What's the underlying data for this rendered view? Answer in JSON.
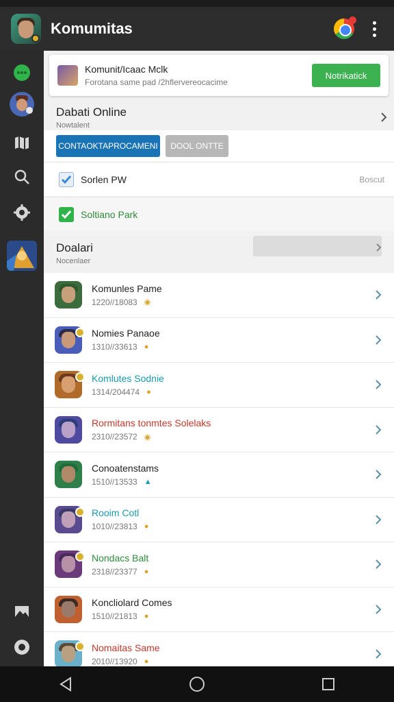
{
  "app": {
    "title": "Komumitas"
  },
  "promo": {
    "title": "Komunit/Icaac Mclk",
    "subtitle": "Forotana same pad /2hflervereocacime",
    "button": "Notrikatick"
  },
  "online_section": {
    "title": "Dabati Online",
    "subtitle": "Nowtalent"
  },
  "buttons": {
    "primary": "CONTAOKTAPROCAMENI",
    "secondary": "DOOL ONTTE"
  },
  "options": [
    {
      "label": "Sorlen PW",
      "side_text": "Boscut",
      "checked_style": "blue"
    },
    {
      "label": "Soltiano Park",
      "side_text": "",
      "checked_style": "green"
    }
  ],
  "list_section": {
    "title": "Doalari",
    "subtitle": "Nocenlaer"
  },
  "list": [
    {
      "title": "Komunles Pame",
      "sub": "1220//18083",
      "title_color": "#222222",
      "mark": "◉",
      "mark_color": "#d8a32a",
      "face": "#c7a07a",
      "hair": "#2f5a2f",
      "bg": "#3c6b3e",
      "badge": false
    },
    {
      "title": "Nomies Panaoe",
      "sub": "1310//33613",
      "title_color": "#222222",
      "mark": "●",
      "mark_color": "#d8a32a",
      "face": "#c99a7a",
      "hair": "#2a2d4a",
      "bg": "#4a5db8",
      "badge": true
    },
    {
      "title": "Komlutes Sodnie",
      "sub": "1314/204474",
      "title_color": "#1a9ab0",
      "mark": "●",
      "mark_color": "#d8a32a",
      "face": "#d8a070",
      "hair": "#6b3a20",
      "bg": "#b06a2a",
      "badge": true
    },
    {
      "title": "Rormitans tonmtes Solelaks",
      "sub": "2310//23572",
      "title_color": "#c0392b",
      "mark": "◉",
      "mark_color": "#d8a32a",
      "face": "#b9a0c8",
      "hair": "#2d3d7a",
      "bg": "#4d4aa0",
      "badge": false
    },
    {
      "title": "Conoatenstams",
      "sub": "1510//13533",
      "title_color": "#222222",
      "mark": "▲",
      "mark_color": "#1a9ab0",
      "face": "#b08a68",
      "hair": "#1f6b3a",
      "bg": "#2f7f4a",
      "badge": false
    },
    {
      "title": "Rooim Cotl",
      "sub": "1010//23813",
      "title_color": "#1a9ab0",
      "mark": "●",
      "mark_color": "#d8a32a",
      "face": "#c0a0b8",
      "hair": "#3a3a6a",
      "bg": "#5a4a90",
      "badge": true
    },
    {
      "title": "Nondacs Balt",
      "sub": "2318//23377",
      "title_color": "#2e8b3a",
      "mark": "●",
      "mark_color": "#d8a32a",
      "face": "#b890a8",
      "hair": "#4a2a5a",
      "bg": "#6a3a7a",
      "badge": true
    },
    {
      "title": "Koncliolard Comes",
      "sub": "1510//21813",
      "title_color": "#222222",
      "mark": "●",
      "mark_color": "#d8a32a",
      "face": "#9a7a6a",
      "hair": "#3a2a22",
      "bg": "#c06030",
      "badge": false
    },
    {
      "title": "Nomaitas Same",
      "sub": "2010//13920",
      "title_color": "#c0392b",
      "mark": "●",
      "mark_color": "#d8a32a",
      "face": "#b8a080",
      "hair": "#5a4a3a",
      "bg": "#6ab0c8",
      "badge": true
    }
  ],
  "sidebar": {
    "icons": [
      "chat-icon",
      "profile-avatar",
      "map-icon",
      "search-icon",
      "settings-icon",
      "game-thumbnail",
      "gallery-icon",
      "record-icon"
    ]
  },
  "colors": {
    "accent_green": "#3bb24f",
    "accent_blue": "#1a73b5",
    "app_bar": "#2d2d2d"
  }
}
